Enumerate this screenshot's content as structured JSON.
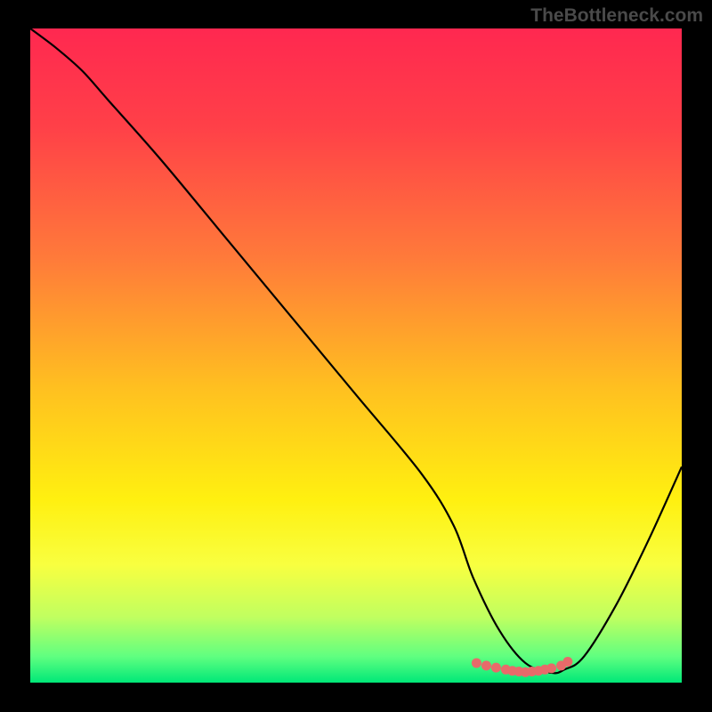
{
  "watermark": "TheBottleneck.com",
  "chart_data": {
    "type": "line",
    "title": "",
    "xlabel": "",
    "ylabel": "",
    "xlim": [
      0,
      100
    ],
    "ylim": [
      0,
      100
    ],
    "gradient_stops": [
      {
        "offset": 0,
        "color": "#ff2850"
      },
      {
        "offset": 15,
        "color": "#ff4048"
      },
      {
        "offset": 35,
        "color": "#ff7a3a"
      },
      {
        "offset": 55,
        "color": "#ffc020"
      },
      {
        "offset": 72,
        "color": "#fff010"
      },
      {
        "offset": 82,
        "color": "#f8ff40"
      },
      {
        "offset": 90,
        "color": "#c0ff60"
      },
      {
        "offset": 96,
        "color": "#60ff80"
      },
      {
        "offset": 100,
        "color": "#00e878"
      }
    ],
    "series": [
      {
        "name": "curve",
        "x": [
          0,
          4,
          8,
          12,
          20,
          30,
          40,
          50,
          60,
          65,
          68,
          72,
          76,
          80,
          82,
          85,
          90,
          95,
          100
        ],
        "values": [
          100,
          97,
          93.5,
          89,
          80,
          68,
          56,
          44,
          32,
          24,
          16,
          8,
          3,
          1.5,
          2,
          4,
          12,
          22,
          33
        ]
      }
    ],
    "markers": {
      "name": "highlight-band",
      "color": "#e86a6a",
      "x": [
        68.5,
        70,
        71.5,
        73,
        74,
        75,
        76,
        77,
        78,
        79,
        80,
        81.5,
        82.5
      ],
      "values": [
        3.0,
        2.6,
        2.3,
        2.0,
        1.8,
        1.7,
        1.6,
        1.7,
        1.8,
        2.0,
        2.2,
        2.6,
        3.2
      ]
    }
  }
}
